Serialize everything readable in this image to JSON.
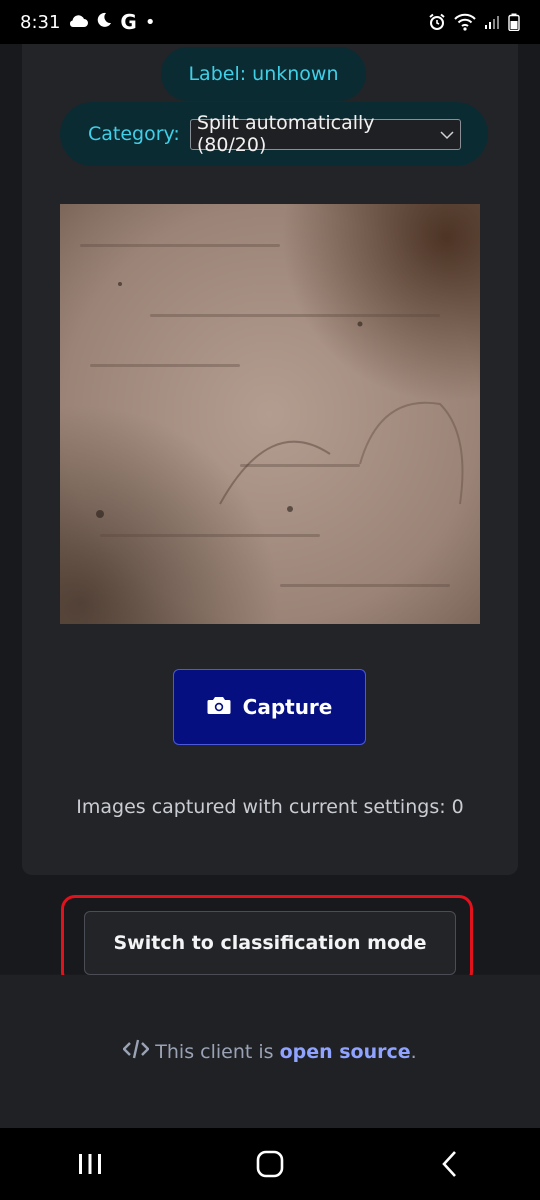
{
  "status_bar": {
    "time": "8:31",
    "left_icons": [
      "cloud-icon",
      "moon-icon",
      "google-icon",
      "dot-icon"
    ],
    "right_icons": [
      "alarm-icon",
      "wifi-icon",
      "signal-icon",
      "battery-icon"
    ],
    "google_glyph": "G",
    "dot_glyph": "•"
  },
  "top": {
    "label_text": "Label: unknown",
    "category_label": "Category:",
    "category_selected": "Split automatically (80/20)"
  },
  "camera": {
    "capture_label": "Capture",
    "capture_icon": "camera-icon"
  },
  "counter": {
    "text": "Images captured with current settings: 0"
  },
  "actions": {
    "switch_label": "Switch to classification mode"
  },
  "footer": {
    "prefix": "This client is",
    "link_text": "open source",
    "suffix": ".",
    "icon": "code-icon"
  },
  "nav": {
    "items": [
      "recent-apps",
      "home",
      "back"
    ]
  },
  "colors": {
    "accent": "#3fd0e8",
    "capture_bg": "#050f80",
    "highlight": "#e2121c",
    "link": "#8fa3ff"
  }
}
